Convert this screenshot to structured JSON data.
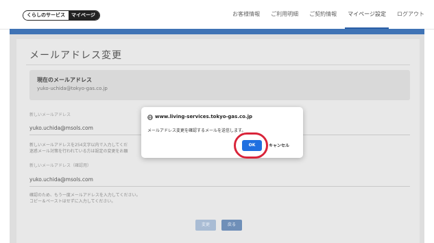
{
  "header": {
    "logo_part1": "くらしのサービス",
    "logo_part2": "マイページ",
    "nav": [
      {
        "label": "お客様情報"
      },
      {
        "label": "ご利用明細"
      },
      {
        "label": "ご契約情報"
      },
      {
        "label": "マイページ設定",
        "active": true
      },
      {
        "label": "ログアウト"
      }
    ],
    "accent_color": "#3f73b5"
  },
  "page": {
    "title": "メールアドレス変更",
    "current": {
      "label": "現在のメールアドレス",
      "value": "yuko-uchida@tokyo-gas.co.jp"
    },
    "new_email": {
      "label": "新しいメールアドレス",
      "value": "yuko.uchida@msols.com"
    },
    "note1_line1": "新しいメールアドレスを254文字以内で入力してくだ",
    "note1_line2": "迷惑メール対策を行われている方は設定の変更をお願",
    "confirm_email": {
      "label": "新しいメールアドレス（確認用）",
      "value": "yuko.uchida@msols.com"
    },
    "note2_line1": "確認のため、もう一度メールアドレスを入力してください。",
    "note2_line2": "コピー＆ペーストはせずに入力してください。",
    "change_button": "変更",
    "back_button": "戻る"
  },
  "dialog": {
    "domain": "www.living-services.tokyo-gas.co.jp",
    "message": "メールアドレス変更を確認するメールを送信します。",
    "ok_label": "OK",
    "cancel_label": "キャンセル",
    "ok_color": "#1f6fe0",
    "highlight_color": "#d9243a"
  }
}
